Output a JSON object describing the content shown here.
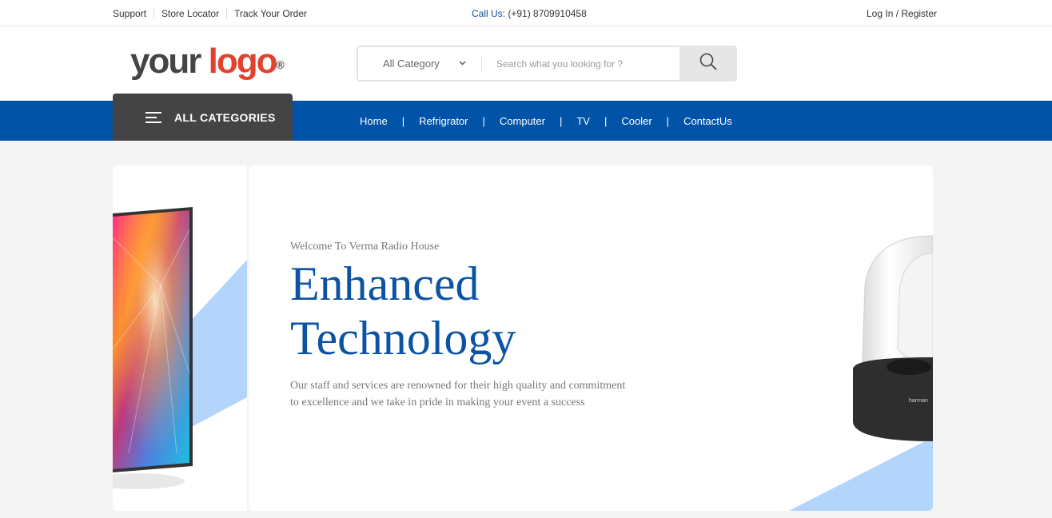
{
  "topbar": {
    "links": [
      "Support",
      "Store Locator",
      "Track Your Order"
    ],
    "call_label": "Call Us:",
    "call_number": " (+91) 8709910458",
    "login": "Log In / Register"
  },
  "header": {
    "logo_part1": "your",
    "logo_part2": "logo",
    "logo_mark": "®",
    "search_category": "All Category",
    "search_placeholder": "Search what you looking for ?",
    "icons": [
      "chevron-down-icon",
      "search-icon"
    ]
  },
  "nav": {
    "all_categories": "ALL CATEGORIES",
    "items": [
      "Home",
      "Refrigrator",
      "Computer",
      "TV",
      "Cooler",
      "ContactUs"
    ],
    "separator": "|"
  },
  "hero": {
    "welcome": "Welcome To Verma Radio House",
    "headline_line1": "Enhanced",
    "headline_line2": "Technology",
    "description": " Our staff and services are renowned for their high quality and commitment to excellence and we take in pride in making your event a success",
    "speaker_brand": "harman",
    "accent_color": "#0c53a3",
    "stripe_color": "#b3d4fb"
  }
}
